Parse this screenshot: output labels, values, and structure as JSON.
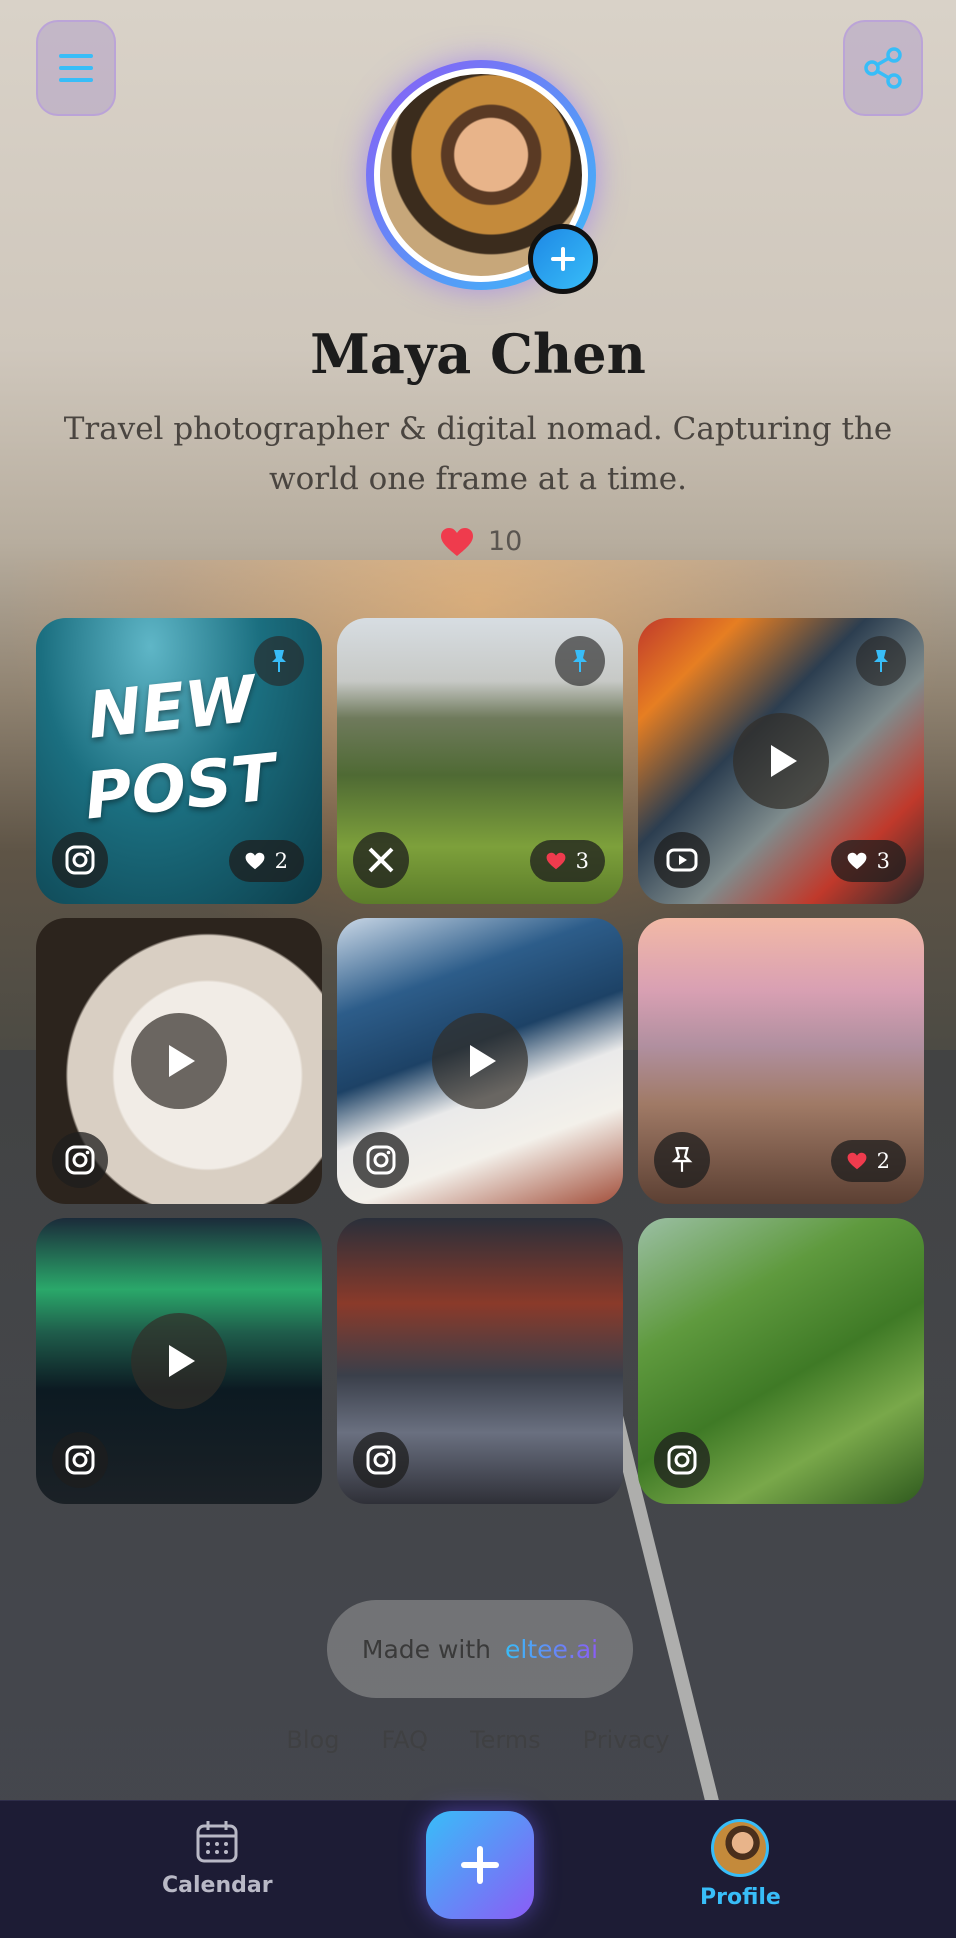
{
  "profile": {
    "name": "Maya Chen",
    "bio": "Travel photographer & digital nomad. Capturing the world one frame at a time.",
    "likes": "10"
  },
  "tiles": [
    {
      "platform": "instagram-icon",
      "overlay_text_1": "NEW",
      "overlay_text_2": "POST",
      "pinned": true,
      "likes": "2",
      "liked": false,
      "video": false
    },
    {
      "platform": "x-icon",
      "pinned": true,
      "likes": "3",
      "liked": true,
      "video": false
    },
    {
      "platform": "youtube-icon",
      "pinned": true,
      "likes": "3",
      "liked": false,
      "video": true
    },
    {
      "platform": "instagram-icon",
      "pinned": false,
      "video": true
    },
    {
      "platform": "instagram-icon",
      "pinned": false,
      "video": true
    },
    {
      "platform": "pin-icon",
      "pinned": false,
      "likes": "2",
      "liked": true,
      "video": false
    },
    {
      "platform": "instagram-icon",
      "pinned": false,
      "video": true
    },
    {
      "platform": "instagram-icon",
      "pinned": false,
      "video": false
    },
    {
      "platform": "instagram-icon",
      "pinned": false,
      "video": false
    }
  ],
  "footer": {
    "made_with": "Made with",
    "brand": "eltee.ai",
    "links": [
      "Blog",
      "FAQ",
      "Terms",
      "Privacy"
    ]
  },
  "nav": {
    "calendar_label": "Calendar",
    "profile_label": "Profile"
  },
  "colors": {
    "accent": "#38bdf8",
    "accent2": "#8b5cf6",
    "heart": "#ef3b4d",
    "nav_bg": "#1d1c35"
  }
}
